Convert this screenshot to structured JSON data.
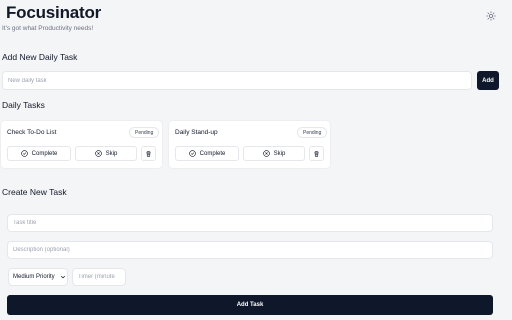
{
  "header": {
    "title": "Focusinator",
    "subtitle": "It's got what Productivity needs!",
    "theme_icon": "sun-icon"
  },
  "add_daily": {
    "heading": "Add New Daily Task",
    "placeholder": "New daily task",
    "value": "",
    "button_label": "Add"
  },
  "daily_tasks": {
    "heading": "Daily Tasks",
    "items": [
      {
        "name": "Check To-Do List",
        "status": "Pending",
        "complete_label": "Complete",
        "skip_label": "Skip"
      },
      {
        "name": "Daily Stand-up",
        "status": "Pending",
        "complete_label": "Complete",
        "skip_label": "Skip"
      }
    ]
  },
  "create_task": {
    "heading": "Create New Task",
    "title_placeholder": "Task title",
    "description_placeholder": "Description (optional)",
    "priority_selected": "Medium Priority",
    "timer_placeholder": "Timer (minute",
    "button_label": "Add Task"
  },
  "colors": {
    "primary": "#0f172a",
    "background": "#f4f5f7",
    "card": "#ffffff",
    "border": "#e5e7eb"
  }
}
